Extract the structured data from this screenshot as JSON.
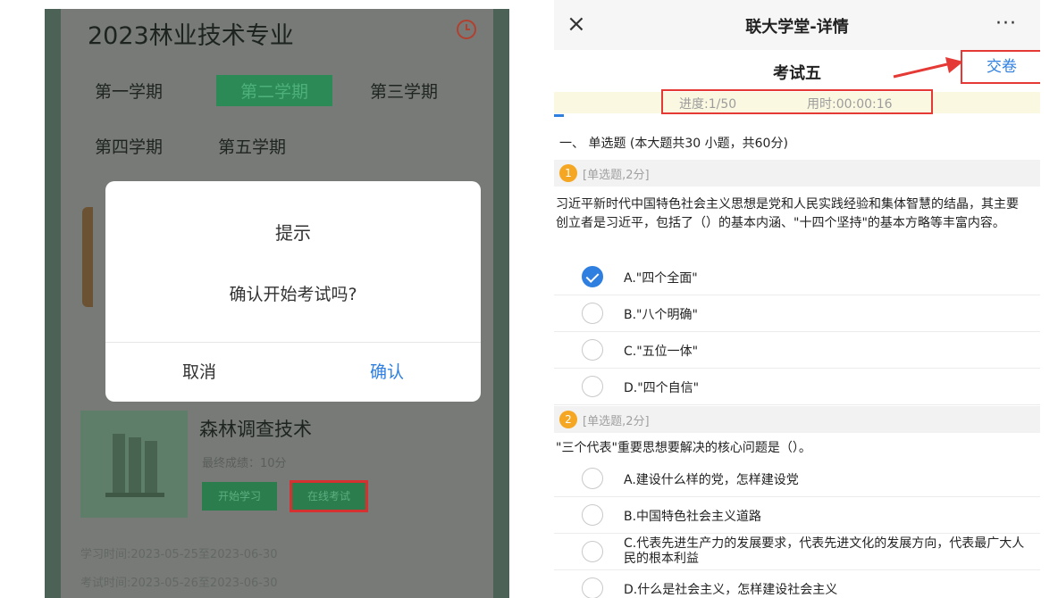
{
  "left": {
    "program_title": "2023林业技术专业",
    "clock_icon": "clock-icon",
    "semesters": [
      "第一学期",
      "第二学期",
      "第三学期",
      "第四学期",
      "第五学期"
    ],
    "active_semester": "第二学期",
    "course": {
      "name": "森林调查技术",
      "final_score": "最终成绩：10分",
      "start_study": "开始学习",
      "online_exam": "在线考试",
      "study_time": "学习时间:2023-05-25至2023-06-30",
      "exam_time": "考试时间:2023-05-26至2023-06-30"
    },
    "dialog": {
      "title": "提示",
      "message": "确认开始考试吗?",
      "cancel": "取消",
      "confirm": "确认"
    }
  },
  "right": {
    "nav_title": "联大学堂-详情",
    "close_icon": "×",
    "more_icon": "···",
    "exam_title": "考试五",
    "submit_label": "交卷",
    "progress_text": "进度:1/50",
    "time_text": "用时:00:00:16",
    "progress": {
      "current": 1,
      "total": 50
    },
    "section_heading": "一、 单选题 (本大题共30 小题，共60分)",
    "questions": [
      {
        "number": "1",
        "type": "[单选题,2分]",
        "text": "习近平新时代中国特色社会主义思想是党和人民实践经验和集体智慧的结晶，其主要创立者是习近平，包括了（）的基本内涵、\"十四个坚持\"的基本方略等丰富内容。",
        "options": [
          "A.\"四个全面\"",
          "B.\"八个明确\"",
          "C.\"五位一体\"",
          "D.\"四个自信\""
        ],
        "selected": 0
      },
      {
        "number": "2",
        "type": "[单选题,2分]",
        "text": "\"三个代表\"重要思想要解决的核心问题是（）。",
        "options": [
          "A.建设什么样的党，怎样建设党",
          "B.中国特色社会主义道路",
          "C.代表先进生产力的发展要求，代表先进文化的发展方向，代表最广大人民的根本利益",
          "D.什么是社会主义，怎样建设社会主义"
        ],
        "selected": -1
      }
    ]
  },
  "colors": {
    "accent_blue": "#2f7fe0",
    "highlight_red": "#e53935",
    "green": "#2b8a56"
  }
}
